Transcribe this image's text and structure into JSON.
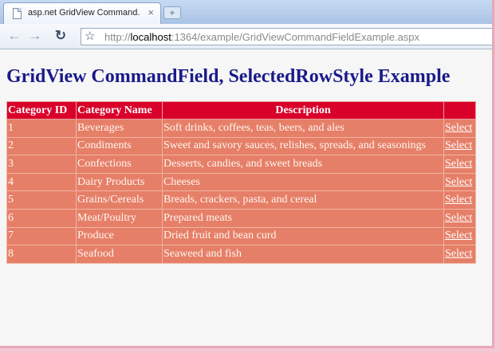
{
  "browser": {
    "tab_title": "asp.net GridView Command...",
    "tab_close": "×",
    "new_tab": "+",
    "url_prefix": "http://",
    "url_host": "localhost",
    "url_rest": ":1364/example/GridViewCommandFieldExample.aspx"
  },
  "page": {
    "heading": "GridView CommandField, SelectedRowStyle Example"
  },
  "grid": {
    "headers": [
      "Category ID",
      "Category Name",
      "Description",
      ""
    ],
    "select_label": "Select",
    "rows": [
      {
        "id": "1",
        "name": "Beverages",
        "desc": "Soft drinks, coffees, teas, beers, and ales"
      },
      {
        "id": "2",
        "name": "Condiments",
        "desc": "Sweet and savory sauces, relishes, spreads, and seasonings"
      },
      {
        "id": "3",
        "name": "Confections",
        "desc": "Desserts, candies, and sweet breads"
      },
      {
        "id": "4",
        "name": "Dairy Products",
        "desc": "Cheeses"
      },
      {
        "id": "5",
        "name": "Grains/Cereals",
        "desc": "Breads, crackers, pasta, and cereal"
      },
      {
        "id": "6",
        "name": "Meat/Poultry",
        "desc": "Prepared meats"
      },
      {
        "id": "7",
        "name": "Produce",
        "desc": "Dried fruit and bean curd"
      },
      {
        "id": "8",
        "name": "Seafood",
        "desc": "Seaweed and fish"
      }
    ]
  },
  "colors": {
    "header_bg": "#d9002a",
    "row_bg": "#e67f68",
    "heading_color": "#1a1a8a"
  }
}
